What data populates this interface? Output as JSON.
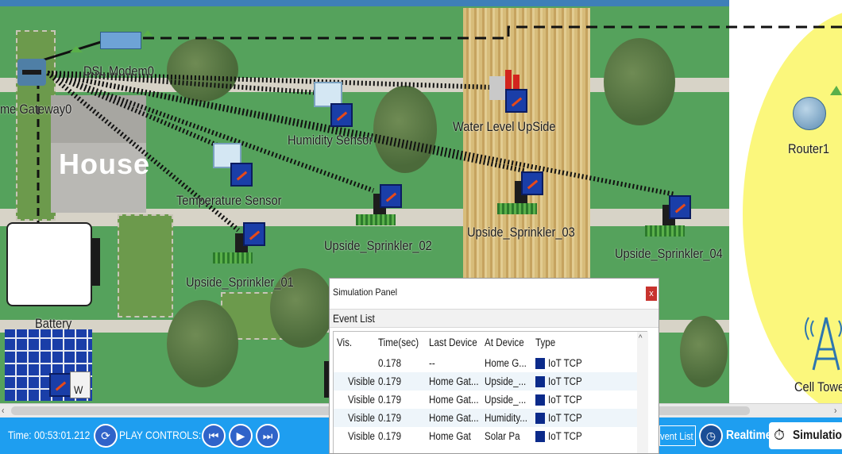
{
  "canvas": {
    "house": "House",
    "devices": {
      "home_gateway": "me Gateway0",
      "dsl_modem": "DSL Modem0",
      "humidity_sensor": "Humidity Sensor",
      "temperature_sensor": "Temperature Sensor",
      "water_level": "Water Level UpSide",
      "sprinkler_01": "Upside_Sprinkler_01",
      "sprinkler_02": "Upside_Sprinkler_02",
      "sprinkler_03": "Upside_Sprinkler_03",
      "sprinkler_04": "Upside_Sprinkler_04",
      "battery": "Battery",
      "router": "Router1",
      "cell_tower": "Cell Towe",
      "solar_label": "W"
    }
  },
  "simulation_panel": {
    "title": "Simulation Panel",
    "close": "x",
    "event_list_title": "Event List",
    "columns": [
      "Vis.",
      "Time(sec)",
      "Last Device",
      "At Device",
      "Type"
    ],
    "rows": [
      {
        "vis": "",
        "time": "0.178",
        "last": "--",
        "at": "Home G...",
        "type": "IoT TCP",
        "color": "#0b2a8a"
      },
      {
        "vis": "Visible",
        "time": "0.179",
        "last": "Home Gat...",
        "at": "Upside_...",
        "type": "IoT TCP",
        "color": "#0b2a8a"
      },
      {
        "vis": "Visible",
        "time": "0.179",
        "last": "Home Gat...",
        "at": "Upside_...",
        "type": "IoT TCP",
        "color": "#0b2a8a"
      },
      {
        "vis": "Visible",
        "time": "0.179",
        "last": "Home Gat...",
        "at": "Humidity...",
        "type": "IoT TCP",
        "color": "#0b2a8a"
      },
      {
        "vis": "Visible",
        "time": "0.179",
        "last": "Home Gat",
        "at": "Solar Pa",
        "type": "IoT TCP",
        "color": "#0b2a8a"
      }
    ]
  },
  "bottom_bar": {
    "time": "Time: 00:53:01.212",
    "play_controls": "PLAY CONTROLS:",
    "event_list_button": "vent List",
    "realtime": "Realtime",
    "simulation": "Simulatio"
  },
  "colors": {
    "bar": "#1e9ef0",
    "cell_zone": "#fbf77c",
    "event_type": "#0b2a8a"
  }
}
